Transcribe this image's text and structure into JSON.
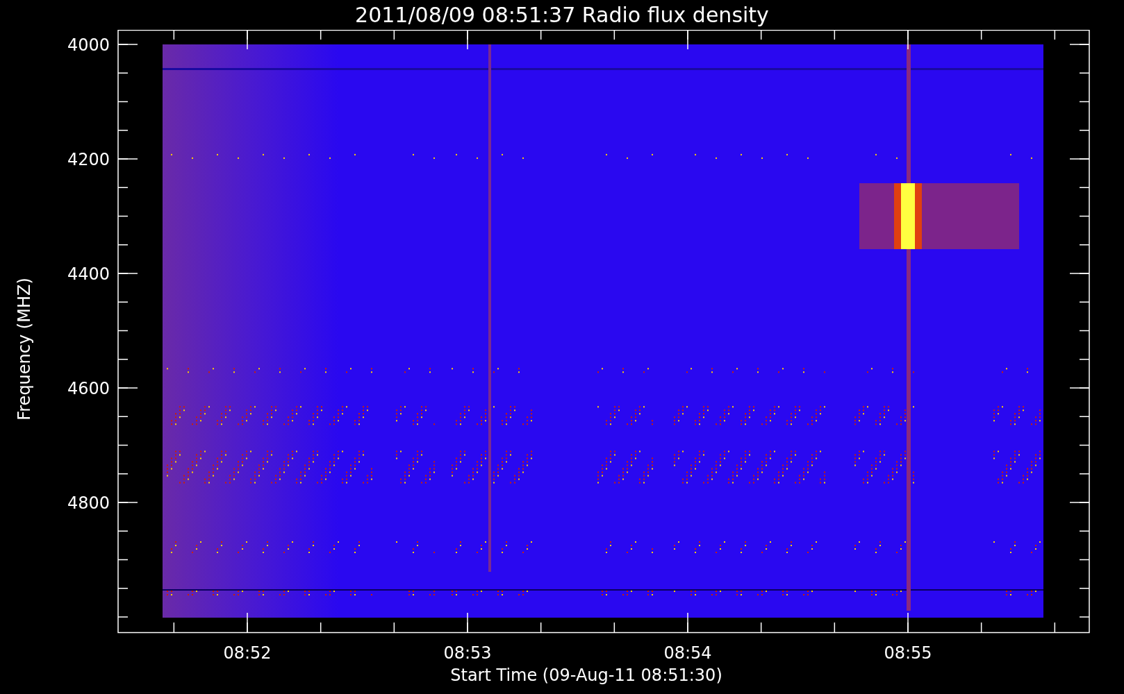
{
  "title": "2011/08/09 08:51:37 Radio flux density",
  "y_axis": {
    "label": "Frequency (MHZ)",
    "ticks": [
      "4000",
      "4200",
      "4400",
      "4600",
      "4800"
    ]
  },
  "x_axis": {
    "label": "Start Time (09-Aug-11 08:51:30)",
    "ticks": [
      "08:52",
      "08:53",
      "08:54",
      "08:55"
    ]
  }
}
